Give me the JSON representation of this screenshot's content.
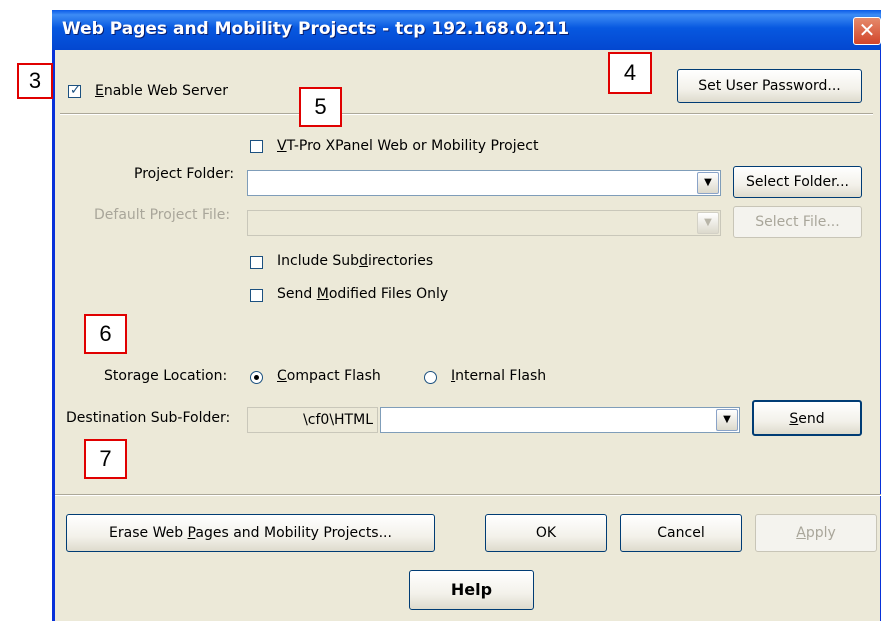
{
  "window": {
    "title": "Web Pages and Mobility Projects - tcp 192.168.0.211",
    "close_glyph": "✕"
  },
  "web_server": {
    "enable_label_prefix": "",
    "enable_label_hotkey": "E",
    "enable_label_rest": "nable Web Server",
    "checked": true,
    "check_glyph": "✓"
  },
  "set_user_password_button": "Set User Password...",
  "vtpro_checkbox": {
    "hotkey": "V",
    "rest": "T-Pro XPanel Web or Mobility Project",
    "checked": false
  },
  "project_folder": {
    "label": "Project Folder:",
    "value": "",
    "select_button": "Select Folder..."
  },
  "default_project_file": {
    "label": "Default Project File:",
    "value": "",
    "select_button": "Select File..."
  },
  "include_subdirectories": {
    "prefix": "Include Sub",
    "hotkey": "d",
    "rest": "irectories",
    "checked": false
  },
  "send_modified": {
    "prefix": "Send ",
    "hotkey": "M",
    "rest": "odified Files Only",
    "checked": false
  },
  "storage_location": {
    "label": "Storage Location:",
    "options": [
      {
        "hotkey": "C",
        "rest": "ompact Flash",
        "selected": true
      },
      {
        "hotkey": "I",
        "rest": "nternal Flash",
        "selected": false
      }
    ]
  },
  "destination": {
    "label": "Destination Sub-Folder:",
    "prefix": "\\cf0\\HTML",
    "value": "",
    "send_hotkey": "S",
    "send_rest": "end"
  },
  "bottom_buttons": {
    "erase_prefix": "Erase Web ",
    "erase_hotkey": "P",
    "erase_rest": "ages and Mobility Projects...",
    "ok": "OK",
    "cancel": "Cancel",
    "apply_hotkey": "A",
    "apply_rest": "pply",
    "help": "Help"
  },
  "dropdown_glyph": "▼",
  "callouts": [
    "3",
    "4",
    "5",
    "6",
    "7"
  ],
  "colors": {
    "title_bar": "#0758e0",
    "dialog_bg": "#ece9d8",
    "callout_border": "#e00000"
  }
}
